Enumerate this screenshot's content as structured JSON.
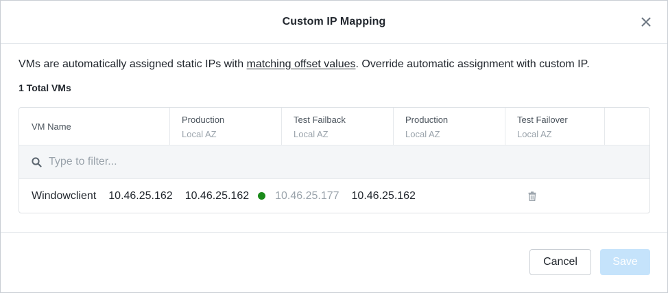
{
  "dialog": {
    "title": "Custom IP Mapping",
    "description_before": "VMs are automatically assigned static IPs with ",
    "description_link": "matching offset values",
    "description_after": ". Override automatic assignment with custom IP.",
    "total_vms": "1 Total VMs"
  },
  "table": {
    "columns": [
      {
        "line1": "VM Name",
        "line2": ""
      },
      {
        "line1": "Production",
        "line2": "Local AZ"
      },
      {
        "line1": "Test Failback",
        "line2": "Local AZ"
      },
      {
        "line1": "Production",
        "line2": "Local AZ"
      },
      {
        "line1": "Test Failover",
        "line2": "Local AZ"
      }
    ],
    "filter_placeholder": "Type to filter...",
    "rows": [
      {
        "vm_name": "Windowclient",
        "production_ip": "10.46.25.162",
        "test_failback_ip": "10.46.25.162",
        "production_target_ip": "10.46.25.177",
        "test_failover_ip": "10.46.25.162"
      }
    ]
  },
  "footer": {
    "cancel_label": "Cancel",
    "save_label": "Save"
  },
  "colors": {
    "status_green": "#1a8a1a",
    "save_disabled": "#c5e3fb",
    "text": "#22272e",
    "muted": "#9aa3ab"
  },
  "icons": {
    "close": "close-icon",
    "search": "search-icon",
    "delete": "trash-icon",
    "status": "status-dot"
  }
}
